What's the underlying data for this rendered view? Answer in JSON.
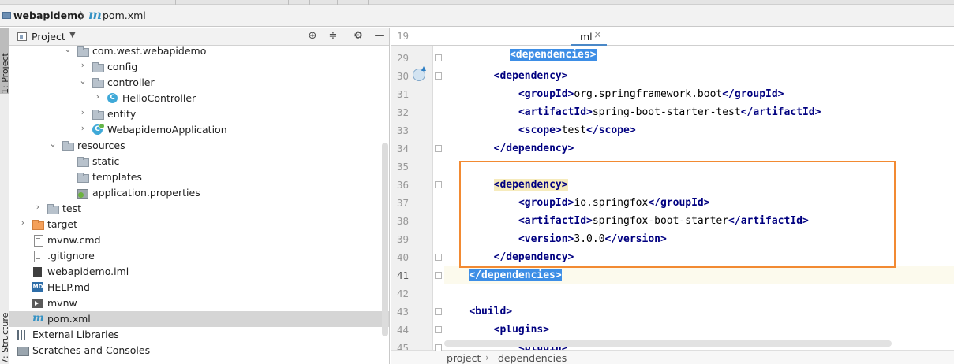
{
  "breadcrumb": {
    "project": "webapidemo",
    "separator": "〉",
    "file": "pom.xml",
    "file_icon": "m"
  },
  "tool_strip": {
    "project_tab": "1: Project",
    "structure_tab": "7: Structure"
  },
  "project_panel": {
    "title": "Project",
    "dropdown": "▼",
    "tools": {
      "locate": "⊕",
      "collapse": "≑",
      "settings": "⚙",
      "hide": "—"
    },
    "tree": [
      {
        "label": "com.west.webapidemo",
        "depth": 4,
        "arrow": "⌄",
        "icon": "folder"
      },
      {
        "label": "config",
        "depth": 5,
        "arrow": "›",
        "icon": "folder"
      },
      {
        "label": "controller",
        "depth": 5,
        "arrow": "⌄",
        "icon": "folder"
      },
      {
        "label": "HelloController",
        "depth": 6,
        "arrow": "›",
        "icon": "class",
        "icon_text": "C"
      },
      {
        "label": "entity",
        "depth": 5,
        "arrow": "›",
        "icon": "folder"
      },
      {
        "label": "WebapidemoApplication",
        "depth": 5,
        "arrow": "›",
        "icon": "app",
        "icon_text": "C"
      },
      {
        "label": "resources",
        "depth": 3,
        "arrow": "⌄",
        "icon": "folder"
      },
      {
        "label": "static",
        "depth": 4,
        "arrow": "",
        "icon": "folder"
      },
      {
        "label": "templates",
        "depth": 4,
        "arrow": "",
        "icon": "folder"
      },
      {
        "label": "application.properties",
        "depth": 4,
        "arrow": "",
        "icon": "props"
      },
      {
        "label": "test",
        "depth": 2,
        "arrow": "›",
        "icon": "folder"
      },
      {
        "label": "target",
        "depth": 1,
        "arrow": "›",
        "icon": "folder-orange"
      },
      {
        "label": "mvnw.cmd",
        "depth": 1,
        "arrow": "",
        "icon": "file"
      },
      {
        "label": ".gitignore",
        "depth": 1,
        "arrow": "",
        "icon": "file"
      },
      {
        "label": "webapidemo.iml",
        "depth": 1,
        "arrow": "",
        "icon": "iml"
      },
      {
        "label": "HELP.md",
        "depth": 1,
        "arrow": "",
        "icon": "md",
        "icon_text": "MD"
      },
      {
        "label": "mvnw",
        "depth": 1,
        "arrow": "",
        "icon": "script"
      },
      {
        "label": "pom.xml",
        "depth": 1,
        "arrow": "",
        "icon": "maven",
        "icon_text": "m",
        "selected": true
      },
      {
        "label": "External Libraries",
        "depth": 0,
        "arrow": "›",
        "icon": "libs"
      },
      {
        "label": "Scratches and Consoles",
        "depth": 0,
        "arrow": "",
        "icon": "scratch"
      }
    ]
  },
  "editor": {
    "sticky": {
      "line": "19",
      "tab_text": "ml",
      "tab_close": "×"
    },
    "lines": [
      {
        "no": "29",
        "segments": []
      },
      {
        "no": "30",
        "segments": [
          {
            "t": "    "
          },
          {
            "tag": "<dependency>"
          }
        ]
      },
      {
        "no": "31",
        "segments": [
          {
            "t": "        "
          },
          {
            "tag": "<groupId>"
          },
          {
            "t": "org.springframework.boot"
          },
          {
            "tag": "</groupId>"
          }
        ]
      },
      {
        "no": "32",
        "segments": [
          {
            "t": "        "
          },
          {
            "tag": "<artifactId>"
          },
          {
            "t": "spring-boot-starter-test"
          },
          {
            "tag": "</artifactId>"
          }
        ]
      },
      {
        "no": "33",
        "segments": [
          {
            "t": "        "
          },
          {
            "tag": "<scope>"
          },
          {
            "t": "test"
          },
          {
            "tag": "</scope>"
          }
        ]
      },
      {
        "no": "34",
        "segments": [
          {
            "t": "    "
          },
          {
            "tag": "</dependency>"
          }
        ]
      },
      {
        "no": "35",
        "segments": []
      },
      {
        "no": "36",
        "segments": [
          {
            "t": "    "
          },
          {
            "tag": "<dependency>",
            "hl": "yellow"
          }
        ]
      },
      {
        "no": "37",
        "segments": [
          {
            "t": "        "
          },
          {
            "tag": "<groupId>"
          },
          {
            "t": "io.springfox"
          },
          {
            "tag": "</groupId>"
          }
        ]
      },
      {
        "no": "38",
        "segments": [
          {
            "t": "        "
          },
          {
            "tag": "<artifactId>"
          },
          {
            "t": "springfox-boot-starter"
          },
          {
            "tag": "</artifactId>"
          }
        ]
      },
      {
        "no": "39",
        "segments": [
          {
            "t": "        "
          },
          {
            "tag": "<version>"
          },
          {
            "t": "3.0.0"
          },
          {
            "tag": "</version>"
          }
        ]
      },
      {
        "no": "40",
        "segments": [
          {
            "t": "    "
          },
          {
            "tag": "</dependency>"
          }
        ]
      },
      {
        "no": "41",
        "segments": [
          {
            "tag": "</dependencies>",
            "hl": "blue"
          }
        ],
        "current": true
      },
      {
        "no": "42",
        "segments": []
      },
      {
        "no": "43",
        "segments": [
          {
            "tag": "<build>"
          }
        ]
      },
      {
        "no": "44",
        "segments": [
          {
            "t": "    "
          },
          {
            "tag": "<plugins>"
          }
        ]
      },
      {
        "no": "45",
        "segments": [
          {
            "t": "        "
          },
          {
            "tag": "<plugin>"
          }
        ]
      }
    ],
    "sticky_code": "<dependencies>"
  },
  "status_crumbs": {
    "first": "project",
    "separator": "›",
    "second": "dependencies"
  },
  "colors": {
    "highlight_box": "#f28a32",
    "xml_tag": "#000080",
    "selection_blue": "#3d8ee6"
  }
}
